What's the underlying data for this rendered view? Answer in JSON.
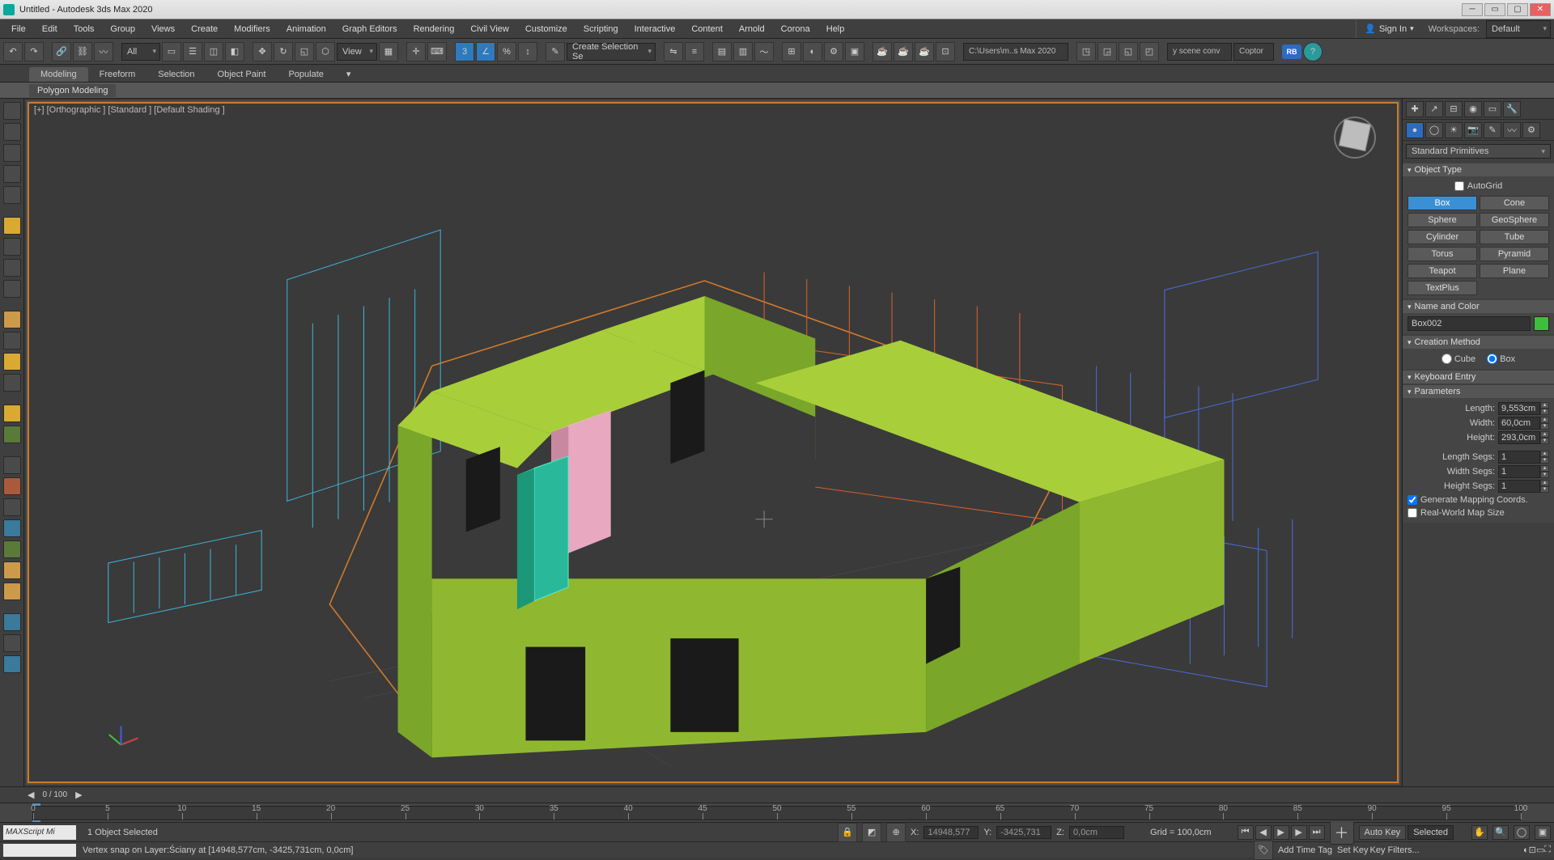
{
  "title": "Untitled - Autodesk 3ds Max 2020",
  "menus": [
    "File",
    "Edit",
    "Tools",
    "Group",
    "Views",
    "Create",
    "Modifiers",
    "Animation",
    "Graph Editors",
    "Rendering",
    "Civil View",
    "Customize",
    "Scripting",
    "Interactive",
    "Content",
    "Arnold",
    "Corona",
    "Help"
  ],
  "signin": "Sign In",
  "workspaces_label": "Workspaces:",
  "workspaces_value": "Default",
  "toolbar": {
    "filter_all": "All",
    "view": "View",
    "create_sel": "Create Selection Se",
    "path": "C:\\Users\\m..s Max 2020",
    "scene_conv": "y scene conv",
    "coptor": "Coptor",
    "user": "RB"
  },
  "ribbon_tabs": [
    "Modeling",
    "Freeform",
    "Selection",
    "Object Paint",
    "Populate"
  ],
  "ribbon_sub": "Polygon Modeling",
  "viewport_label": "[+] [Orthographic ] [Standard ] [Default Shading ]",
  "command_panel": {
    "dropdown": "Standard Primitives",
    "object_type": "Object Type",
    "autogrid": "AutoGrid",
    "primitives": [
      [
        "Box",
        "Cone"
      ],
      [
        "Sphere",
        "GeoSphere"
      ],
      [
        "Cylinder",
        "Tube"
      ],
      [
        "Torus",
        "Pyramid"
      ],
      [
        "Teapot",
        "Plane"
      ],
      [
        "TextPlus",
        ""
      ]
    ],
    "name_color": "Name and Color",
    "object_name": "Box002",
    "creation_method": "Creation Method",
    "cm_cube": "Cube",
    "cm_box": "Box",
    "keyboard_entry": "Keyboard Entry",
    "parameters": "Parameters",
    "length_lbl": "Length:",
    "length_val": "9,553cm",
    "width_lbl": "Width:",
    "width_val": "60,0cm",
    "height_lbl": "Height:",
    "height_val": "293,0cm",
    "lseg_lbl": "Length Segs:",
    "lseg_val": "1",
    "wseg_lbl": "Width Segs:",
    "wseg_val": "1",
    "hseg_lbl": "Height Segs:",
    "hseg_val": "1",
    "gen_map": "Generate Mapping Coords.",
    "real_world": "Real-World Map Size"
  },
  "timeslider": {
    "label": "0 / 100"
  },
  "timeline_ticks": [
    0,
    5,
    10,
    15,
    20,
    25,
    30,
    35,
    40,
    45,
    50,
    55,
    60,
    65,
    70,
    75,
    80,
    85,
    90,
    95,
    100
  ],
  "status": {
    "script": "MAXScript Mi",
    "selection": "1 Object Selected",
    "snap": "Vertex snap on Layer:Ściany at [14948,577cm, -3425,731cm, 0,0cm]",
    "x": "14948,577",
    "y": "-3425,731",
    "z": "0,0cm",
    "grid": "Grid = 100,0cm",
    "add_time": "Add Time Tag",
    "autokey": "Auto Key",
    "selected": "Selected",
    "setkey": "Set Key",
    "keyfilters": "Key Filters..."
  }
}
